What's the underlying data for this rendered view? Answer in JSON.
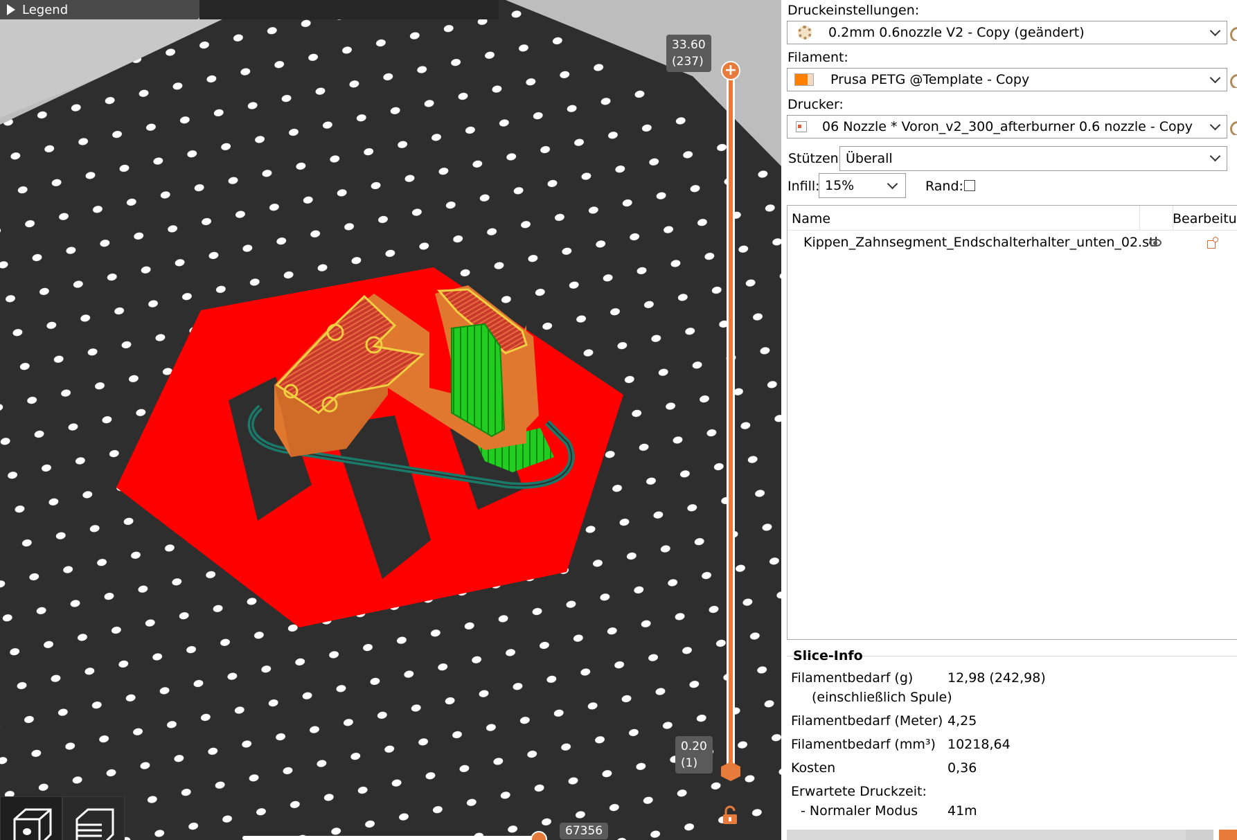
{
  "viewport": {
    "legend_label": "Legend",
    "layer_top_height": "33.60",
    "layer_top_index": "(237)",
    "layer_bottom_height": "0.20",
    "layer_bottom_index": "(1)",
    "move_counter": "67356"
  },
  "panel": {
    "print_settings_label": "Druckeinstellungen:",
    "print_settings_value": "0.2mm 0.6nozzle V2 - Copy (geändert)",
    "filament_label": "Filament:",
    "filament_value": "Prusa PETG @Template - Copy",
    "filament_color": "#ff8000",
    "printer_label": "Drucker:",
    "printer_value": "06 Nozzle * Voron_v2_300_afterburner 0.6 nozzle - Copy",
    "supports_label": "Stützen:",
    "supports_value": "Überall",
    "infill_label": "Infill:",
    "infill_value": "15%",
    "brim_label": "Rand:",
    "brim_checked": false
  },
  "object_list": {
    "columns": [
      "Name",
      "Bearbeitu..."
    ],
    "rows": [
      {
        "name": "Kippen_Zahnsegment_Endschalterhalter_unten_02.stl"
      }
    ]
  },
  "slice_info": {
    "title": "Slice-Info",
    "filament_g_label": "Filamentbedarf (g)",
    "filament_g_sub": "(einschließlich Spule)",
    "filament_g_value": "12,98 (242,98)",
    "filament_m_label": "Filamentbedarf (Meter)",
    "filament_m_value": "4,25",
    "filament_mm3_label": "Filamentbedarf (mm³)",
    "filament_mm3_value": "10218,64",
    "cost_label": "Kosten",
    "cost_value": "0,36",
    "time_label": "Erwartete Druckzeit:",
    "mode_label": "- Normaler Modus",
    "mode_value": "41m"
  },
  "colors": {
    "slider_accent": "#e77b3b",
    "bed": "#2e2e2e",
    "skirt": "#1a7a6a",
    "support": "#22cc22",
    "logo": "#ff0000"
  }
}
